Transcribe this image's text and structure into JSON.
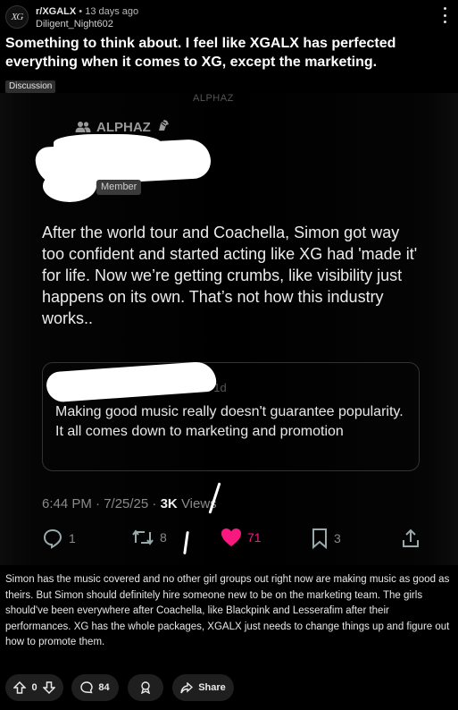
{
  "post": {
    "subreddit": "r/XGALX",
    "time_ago": "13 days ago",
    "author": "Diligent_Night602",
    "title": "Something to think about. I feel like XGALX has perfected everything when it comes to XG, except the marketing.",
    "flair": "Discussion",
    "body": "Simon has the music covered and no other girl groups out right now are making music as good as theirs. But Simon should definitely hire someone new to be on the marketing team. The girls should've been everywhere after Coachella, like Blackpink and Lesserafim after their performances. XG has the whole packages, XGALX just needs to change things up and figure out how to promote them."
  },
  "screenshot": {
    "top_ghost": "ALPHAZ",
    "group_label": "ALPHAZ",
    "member_badge": "Member",
    "tweet_text": "After the world tour and Coachella, Simon got way too confident and started acting like XG had 'made it' for life. Now we’re getting crumbs, like visibility just happens on its own. That’s not how this industry works..",
    "quote_ghost": "ype… · in 1d",
    "quote_text": "Making good music really doesn't guarantee popularity. It all comes down to marketing and promotion",
    "timestamp": "6:44 PM · 7/25/25 · ",
    "views_count": "3K",
    "views_label": "Views",
    "replies": "1",
    "reposts": "8",
    "likes": "71",
    "bookmarks": "3",
    "like_color": "#f91880"
  },
  "actions": {
    "votes": "0",
    "comments": "84",
    "share": "Share"
  }
}
